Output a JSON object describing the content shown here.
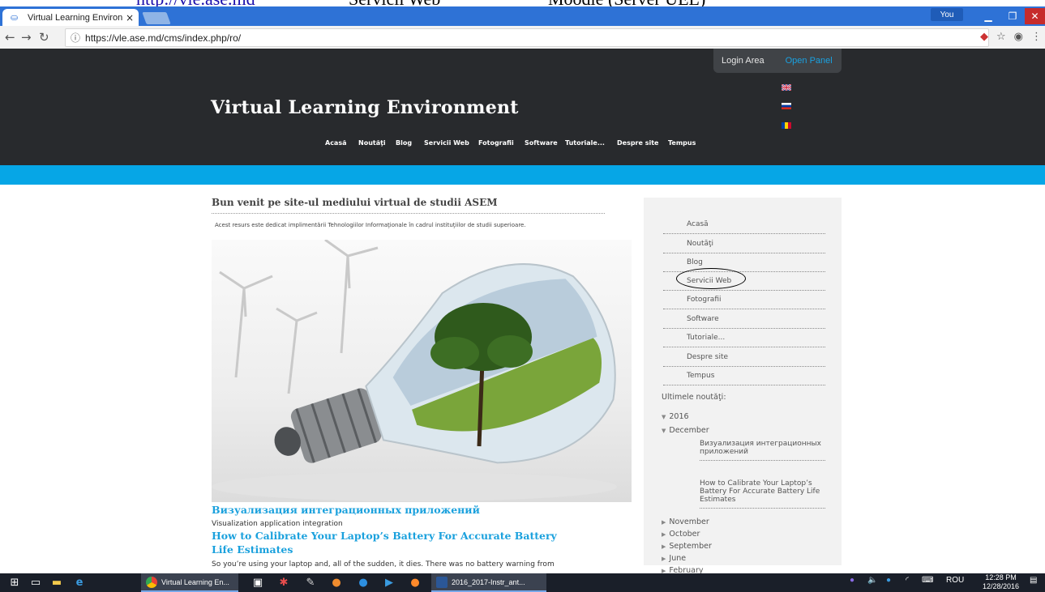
{
  "doc_strip": {
    "link": "http://vle.ase.md",
    "middle": "Servicii Web",
    "right": "Moodle (Server UEL)"
  },
  "browser": {
    "tab_title": "Virtual Learning Environ",
    "tab_close": "×",
    "profile_label": "You",
    "url": "https://vle.ase.md/cms/index.php/ro/"
  },
  "site": {
    "login_area": "Login Area",
    "open_panel": "Open Panel",
    "title": "Virtual Learning Environment",
    "nav": [
      "Acasă",
      "Noutăţi",
      "Blog",
      "Servicii Web",
      "Fotografii",
      "Software",
      "Tutoriale...",
      "Despre site",
      "Tempus"
    ]
  },
  "content": {
    "welcome": "Bun venit pe site-ul mediului virtual de studii ASEM",
    "intro": "Acest resurs este dedicat implimentării Tehnologiilor Informaţionale în cadrul instituţiilor de studii superioare.",
    "article1_title": "Визуализация интеграционных приложений",
    "article1_sub": "Visualization application integration",
    "article2_title_line1": "How to Calibrate Your Laptop’s Battery For Accurate Battery",
    "article2_title_line2": "Life Estimates",
    "article2_text": "So you’re using your laptop and, all of the sudden, it dies. There was no battery warning from"
  },
  "sidebar": {
    "menu": [
      "Acasă",
      "Noutăţi",
      "Blog",
      "Servicii Web",
      "Fotografii",
      "Software",
      "Tutoriale...",
      "Despre site",
      "Tempus"
    ],
    "news_heading": "Ultimele noutăţi:",
    "year": "2016",
    "month": "December",
    "news_item1": "Визуализация интеграционных приложений",
    "news_item2": "How to Calibrate Your Laptop’s Battery For Accurate Battery Life Estimates",
    "months": [
      "November",
      "October",
      "September",
      "June",
      "February"
    ]
  },
  "taskbar": {
    "chrome_app": "Virtual Learning En...",
    "word_app": "2016_2017-Instr_ant...",
    "lang": "ROU",
    "time": "12:28 PM",
    "date": "12/28/2016"
  },
  "colors": {
    "accent_blue": "#06a6e6",
    "header_dark": "#282a2d",
    "article_link": "#1ba1dd"
  }
}
